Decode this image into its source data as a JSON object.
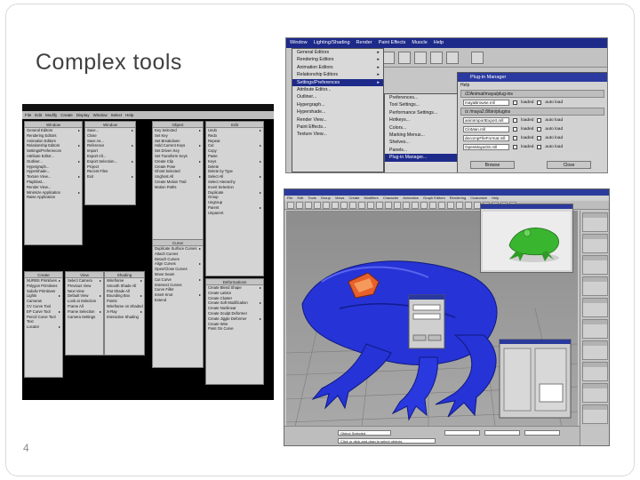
{
  "slide": {
    "title": "Complex tools",
    "number": "4"
  },
  "colors": {
    "frame_border": "#d9d9d9",
    "title_text": "#404040",
    "frog_body": "#2633d6",
    "frog_accent": "#e8602a",
    "render_frog": "#3ab52f",
    "menu_highlight": "#1e2a8a"
  },
  "maya_collage": {
    "menubar": [
      "File",
      "Edit",
      "Modify",
      "Create",
      "Display",
      "Window",
      "Select",
      "Help"
    ],
    "panels": [
      {
        "header": "Window",
        "rows": [
          "General Editors",
          "Rendering Editors",
          "Animation Editors",
          "Relationship Editors",
          "Settings/Preferences",
          "Attribute Editor...",
          "Outliner...",
          "Hypergraph...",
          "Hypershade...",
          "Texture View...",
          "Playblast...",
          "Render View...",
          "Minimize Application",
          "Raise Application"
        ]
      },
      {
        "header": "Window",
        "rows": [
          "Save...",
          "Close",
          "Save As...",
          "Reference",
          "Import",
          "Export All...",
          "Export Selection...",
          "Project",
          "Recent Files",
          "Exit"
        ]
      },
      {
        "header": "Object",
        "rows": [
          "Key Selected",
          "Set Key",
          "Set Breakdown",
          "Hold Current Keys",
          "Set Driven Key",
          "Set Transform Keys",
          "Create Clip",
          "Create Pose",
          "Ghost Selected",
          "Unghost All",
          "Create Motion Trail",
          "Motion Paths"
        ]
      },
      {
        "header": "Edit",
        "rows": [
          "Undo",
          "Redo",
          "Repeat",
          "Cut",
          "Copy",
          "Paste",
          "Keys",
          "Delete",
          "Delete by Type",
          "Select All",
          "Select Hierarchy",
          "Invert Selection",
          "Duplicate",
          "Group",
          "Ungroup",
          "Parent",
          "Unparent"
        ]
      },
      {
        "header": "Create",
        "rows": [
          "NURBS Primitives",
          "Polygon Primitives",
          "Subdiv Primitives",
          "Lights",
          "Cameras",
          "CV Curve Tool",
          "EP Curve Tool",
          "Pencil Curve Tool",
          "Text",
          "Locator"
        ]
      },
      {
        "header": "View",
        "rows": [
          "Select Camera",
          "Previous View",
          "Next View",
          "Default View",
          "Look at Selection",
          "Frame All",
          "Frame Selection",
          "Camera Settings"
        ]
      },
      {
        "header": "Shading",
        "rows": [
          "Wireframe",
          "Smooth Shade All",
          "Flat Shade All",
          "Bounding Box",
          "Points",
          "Wireframe on Shaded",
          "X-Ray",
          "Interactive Shading"
        ]
      },
      {
        "header": "Curve",
        "rows": [
          "Duplicate Surface Curves",
          "Attach Curves",
          "Detach Curves",
          "Align Curves",
          "Open/Close Curves",
          "Move Seam",
          "Cut Curve",
          "Intersect Curves",
          "Curve Fillet",
          "Insert Knot",
          "Extend"
        ]
      },
      {
        "header": "Deformations",
        "rows": [
          "Create Blend Shape",
          "Create Lattice",
          "Create Cluster",
          "Create Soft Modification",
          "Create Nonlinear",
          "Create Sculpt Deformer",
          "Create Jiggle Deformer",
          "Create Wire",
          "Point On Curve"
        ]
      }
    ]
  },
  "maya_menu_shot": {
    "menubar": [
      "Window",
      "Lighting/Shading",
      "Render",
      "Paint Effects",
      "Muscle",
      "Help"
    ],
    "menu1": [
      "General Editors",
      "Rendering Editors",
      "Animation Editors",
      "Relationship Editors",
      "Settings/Preferences",
      "Attribute Editor...",
      "Outliner...",
      "Hypergraph...",
      "Hypershade...",
      "Render View...",
      "Paint Effects...",
      "Texture View..."
    ],
    "menu1_highlight_index": 4,
    "menu2": [
      "Preferences...",
      "Tool Settings...",
      "Performance Settings...",
      "Hotkeys...",
      "Colors...",
      "Marking Menus...",
      "Shelves...",
      "Panels...",
      "Plug-in Manager..."
    ],
    "menu2_highlight_index": 8,
    "plugin_manager": {
      "title": "Plug-in Manager",
      "menu": "Help",
      "paths": [
        "/Z/Animat/maya/plug-ins",
        "/z /maya2.8/bin/plugins"
      ],
      "rows": [
        {
          "name": "mayaBrowse.mll",
          "loaded": "loaded",
          "auto": "auto load"
        },
        {
          "name": "animImportExport.mll",
          "loaded": "loaded",
          "auto": "auto load"
        },
        {
          "name": "CloMan.mll",
          "loaded": "loaded",
          "auto": "auto load"
        },
        {
          "name": "decompFileFormat.mll",
          "loaded": "loaded",
          "auto": "auto load"
        },
        {
          "name": "OpenMayaOS.mll",
          "loaded": "loaded",
          "auto": "auto load"
        }
      ],
      "buttons": [
        "Browse",
        "Close"
      ]
    }
  },
  "max_shot": {
    "menubar": [
      "File",
      "Edit",
      "Tools",
      "Group",
      "Views",
      "Create",
      "Modifiers",
      "Character",
      "Animation",
      "Graph Editors",
      "Rendering",
      "Customize",
      "Help"
    ],
    "status_fields": [
      "Object Selected",
      "Click or click-and-drag to select objects"
    ]
  }
}
